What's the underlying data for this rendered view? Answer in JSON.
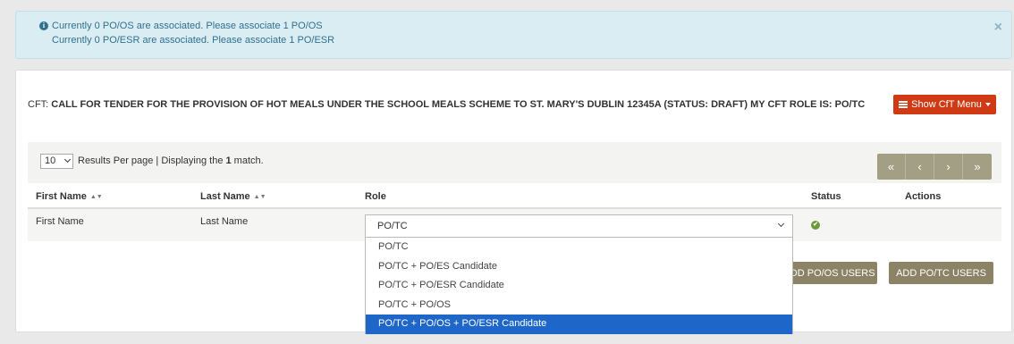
{
  "alert": {
    "line1": "Currently 0 PO/OS are associated. Please associate 1 PO/OS",
    "line2": "Currently 0 PO/ESR are associated. Please associate 1 PO/ESR",
    "close": "×"
  },
  "header": {
    "lead": "CFT: ",
    "title": "CALL FOR TENDER FOR THE PROVISION OF HOT MEALS UNDER THE SCHOOL MEALS SCHEME TO ST. MARY'S DUBLIN 12345A (STATUS: DRAFT) MY CFT ROLE IS: PO/TC",
    "menu_button": "Show CfT Menu"
  },
  "toolbar": {
    "per_page_value": "10",
    "results_prefix": "Results Per page | Displaying the ",
    "results_count": "1",
    "results_suffix": " match.",
    "pager": [
      "«",
      "‹",
      "›",
      "»"
    ]
  },
  "table": {
    "headers": [
      "First Name",
      "Last Name",
      "Role",
      "Status",
      "Actions"
    ],
    "rows": [
      {
        "first_name": "First Name",
        "last_name": "Last Name",
        "role": "PO/TC"
      }
    ]
  },
  "buttons": {
    "add_poos": "ADD PO/OS USERS",
    "add_potc": "ADD PO/TC USERS"
  },
  "role_options": [
    "PO/TC",
    "PO/TC + PO/ES Candidate",
    "PO/TC + PO/ESR Candidate",
    "PO/TC + PO/OS",
    "PO/TC + PO/OS + PO/ESR Candidate"
  ],
  "role_selected_index": 4,
  "colors": {
    "alert_bg": "#d9edf2",
    "menu_button": "#cf3a15",
    "pager": "#a29f85",
    "add_button": "#8c8266",
    "status_ok": "#6d9b3a",
    "option_highlight": "#1f66c9"
  },
  "icons": {
    "alert": "info-circle-icon",
    "menu": "list-icon",
    "status": "check-circle-icon"
  }
}
